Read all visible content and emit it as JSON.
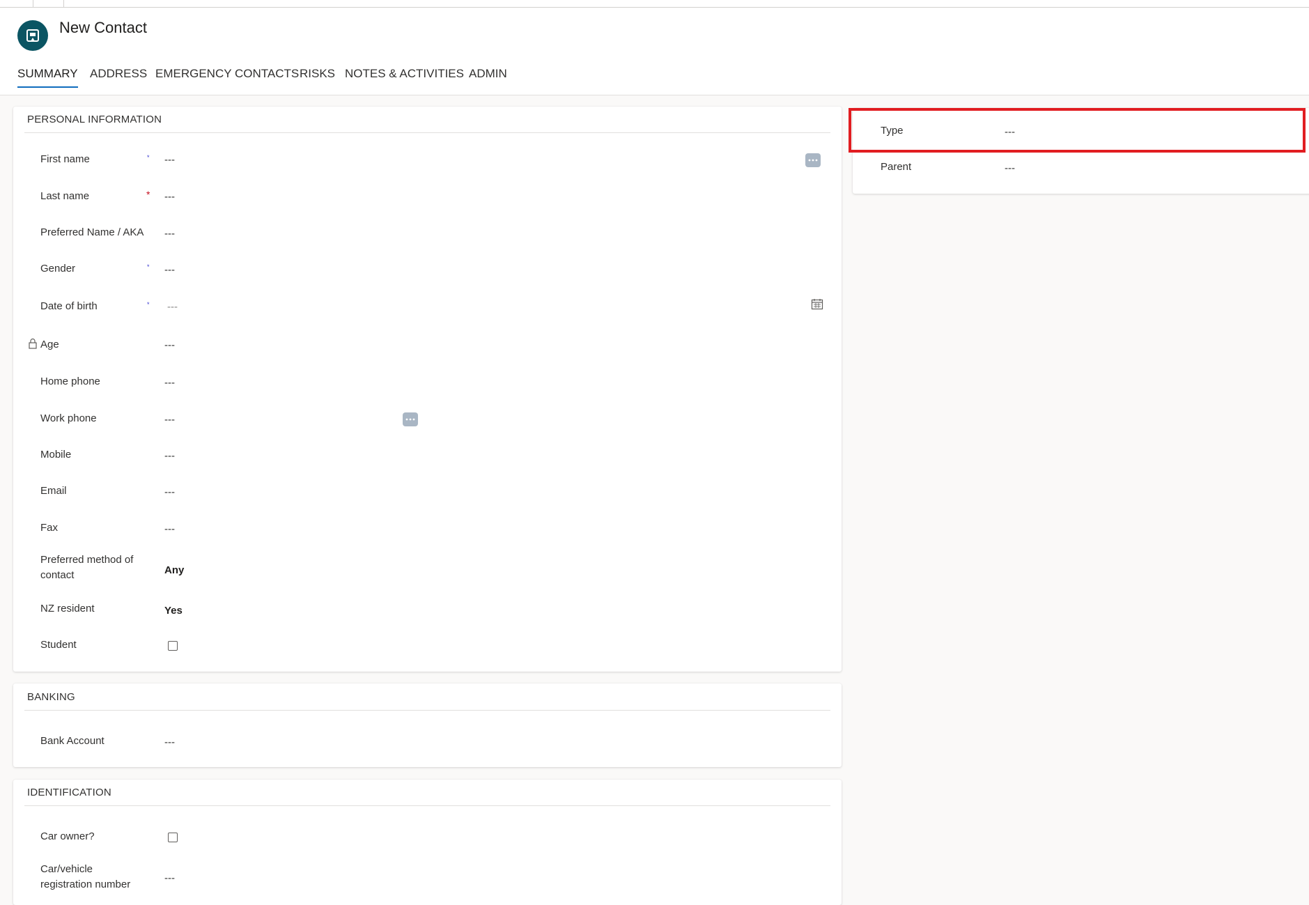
{
  "header": {
    "title": "New Contact"
  },
  "tabs": [
    {
      "label": "SUMMARY",
      "active": true
    },
    {
      "label": "ADDRESS"
    },
    {
      "label": "EMERGENCY CONTACTS"
    },
    {
      "label": "RISKS"
    },
    {
      "label": "NOTES & ACTIVITIES"
    },
    {
      "label": "ADMIN"
    }
  ],
  "personal": {
    "section_title": "PERSONAL INFORMATION",
    "fields": [
      {
        "label": "First name",
        "value": "---",
        "required": "*"
      },
      {
        "label": "Last name",
        "value": "---",
        "required": "*"
      },
      {
        "label": "Preferred Name / AKA",
        "value": "---"
      },
      {
        "label": "Gender",
        "value": "---",
        "required": "*"
      },
      {
        "label": "Date of birth",
        "value": "---",
        "required": "*"
      },
      {
        "label": "Age",
        "value": "---"
      },
      {
        "label": "Home phone",
        "value": "---"
      },
      {
        "label": "Work phone",
        "value": "---"
      },
      {
        "label": "Mobile",
        "value": "---"
      },
      {
        "label": "Email",
        "value": "---"
      },
      {
        "label": "Fax",
        "value": "---"
      },
      {
        "label": "Preferred method of contact",
        "value": "Any"
      },
      {
        "label": "NZ resident",
        "value": "Yes"
      },
      {
        "label": "Student"
      }
    ]
  },
  "banking": {
    "section_title": "BANKING",
    "fields": [
      {
        "label": "Bank Account",
        "value": "---"
      }
    ]
  },
  "identification": {
    "section_title": "IDENTIFICATION",
    "fields": [
      {
        "label": "Car owner?"
      },
      {
        "label": "Car/vehicle registration number",
        "value": "---"
      }
    ]
  },
  "side": {
    "fields": [
      {
        "label": "Type",
        "value": "---"
      },
      {
        "label": "Parent",
        "value": "---"
      }
    ]
  },
  "icons": {
    "avatar": "contact-card-icon",
    "more": "more-options-icon",
    "calendar": "calendar-icon",
    "lock": "lock-icon"
  },
  "colors": {
    "accent": "#0f6cbd",
    "avatar_bg": "#0b5563",
    "required_red": "#c50f1f",
    "highlight": "#e11d21"
  }
}
